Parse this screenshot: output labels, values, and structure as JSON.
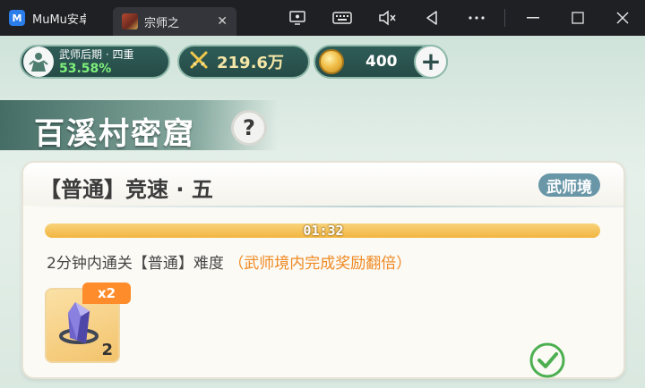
{
  "titlebar": {
    "app_tab_label": "MuMu安卓",
    "game_tab_label": "宗师之",
    "close_tab_glyph": "✕",
    "icons": [
      "screen-record-icon",
      "keyboard-icon",
      "mute-icon",
      "back-icon",
      "more-icon",
      "minimize-icon",
      "maximize-icon",
      "close-icon"
    ]
  },
  "resources": {
    "rank_name": "武师后期 · 四重",
    "rank_percent": "53.58%",
    "power": "219.6万",
    "coins": "400"
  },
  "banner": {
    "title": "百溪村密窟",
    "help": "?"
  },
  "task": {
    "title": "【普通】竞速 · 五",
    "realm": "武师境",
    "timer": "01:32",
    "progress": 1.0,
    "description": "2分钟内通关【普通】难度",
    "bonus": "（武师境内完成奖励翻倍）",
    "reward_multiplier": "x2",
    "reward_count": "2",
    "completed": true
  },
  "colors": {
    "accent_orange": "#f08a24",
    "progress_yellow": "#f2b640",
    "check_green": "#4caf50"
  }
}
